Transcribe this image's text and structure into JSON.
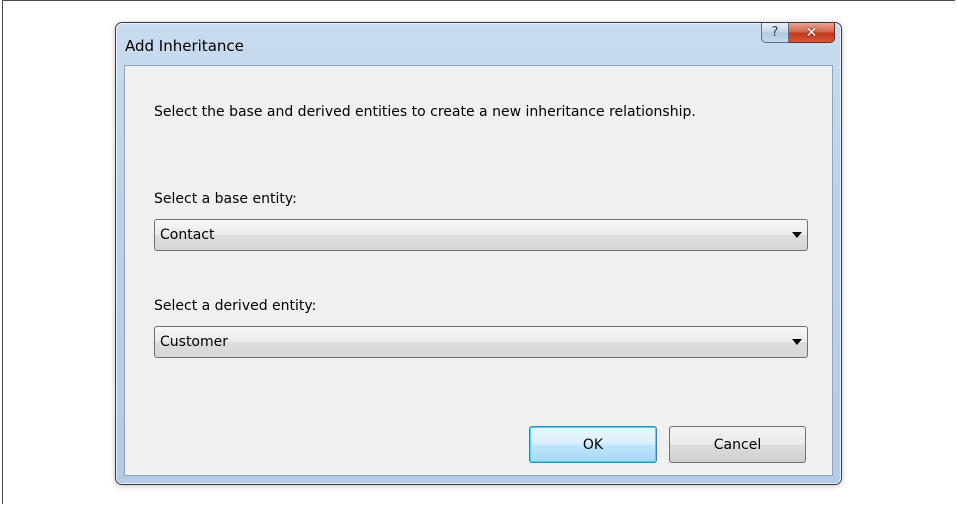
{
  "window": {
    "title": "Add Inheritance",
    "help_glyph": "?",
    "close_glyph": "✕",
    "icons": {
      "help": "help-icon",
      "close": "close-icon",
      "dropdown": "chevron-down-icon"
    }
  },
  "dialog": {
    "instruction": "Select the base and derived entities to create a new inheritance relationship.",
    "base_entity": {
      "label": "Select a base entity:",
      "selected": "Contact"
    },
    "derived_entity": {
      "label": "Select a derived entity:",
      "selected": "Customer"
    },
    "buttons": {
      "ok": "OK",
      "cancel": "Cancel"
    }
  },
  "colors": {
    "close_button": "#c7432a",
    "ok_button_border": "#3c7fb1",
    "window_frame": "#bcd2ea",
    "client_background": "#f0f0f0"
  }
}
